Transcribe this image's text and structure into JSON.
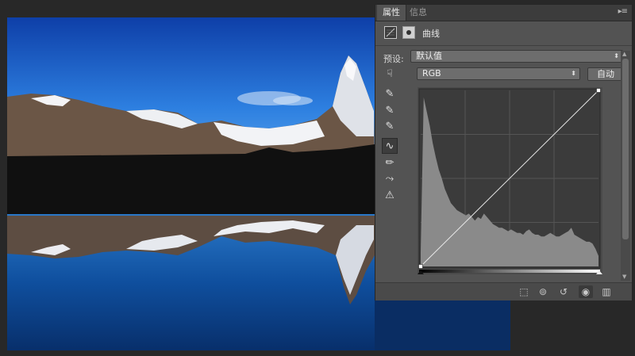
{
  "tabs": [
    {
      "label": "属性",
      "active": true
    },
    {
      "label": "信息",
      "active": false
    }
  ],
  "panel": {
    "menu_icon": "panel-menu-icon",
    "adjustment_icon": "curves-adjustment-icon",
    "mask_icon": "layer-mask-icon",
    "title": "曲线",
    "preset_label": "预设:",
    "preset_value": "默认值",
    "channel_value": "RGB",
    "auto_label": "自动"
  },
  "tools": [
    {
      "name": "on-image-adjust-tool",
      "glyph": "☟",
      "active": false
    },
    {
      "name": "black-point-eyedropper-icon",
      "glyph": "✎",
      "active": false
    },
    {
      "name": "gray-point-eyedropper-icon",
      "glyph": "✎",
      "active": false
    },
    {
      "name": "white-point-eyedropper-icon",
      "glyph": "✎",
      "active": false
    },
    {
      "name": "curve-points-tool",
      "glyph": "∿",
      "active": true
    },
    {
      "name": "pencil-draw-tool",
      "glyph": "✏",
      "active": false
    },
    {
      "name": "smooth-curve-tool",
      "glyph": "⤳",
      "active": false
    },
    {
      "name": "clipping-warning-icon",
      "glyph": "⚠",
      "active": false
    }
  ],
  "curve": {
    "histogram_bins": [
      8,
      96,
      88,
      80,
      70,
      62,
      55,
      50,
      44,
      40,
      36,
      34,
      32,
      31,
      30,
      29,
      30,
      28,
      26,
      28,
      27,
      30,
      28,
      26,
      24,
      23,
      22,
      22,
      21,
      20,
      21,
      20,
      19,
      19,
      18,
      20,
      21,
      19,
      18,
      18,
      17,
      17,
      18,
      19,
      18,
      17,
      17,
      18,
      19,
      20,
      22,
      18,
      17,
      16,
      15,
      14,
      14,
      13,
      10,
      6
    ],
    "points": [
      [
        0,
        0
      ],
      [
        255,
        255
      ]
    ]
  },
  "bottom_buttons": [
    {
      "name": "clip-to-layer-button",
      "glyph": "⬚"
    },
    {
      "name": "view-previous-state-button",
      "glyph": "👁"
    },
    {
      "name": "reset-button",
      "glyph": "↺"
    },
    {
      "name": "toggle-visibility-button",
      "glyph": "◉"
    },
    {
      "name": "delete-adjustment-button",
      "glyph": "🗑"
    }
  ],
  "colors": {
    "panel_bg": "#535353",
    "sky": "#1f5fc4",
    "lake": "#0d3f8a"
  }
}
